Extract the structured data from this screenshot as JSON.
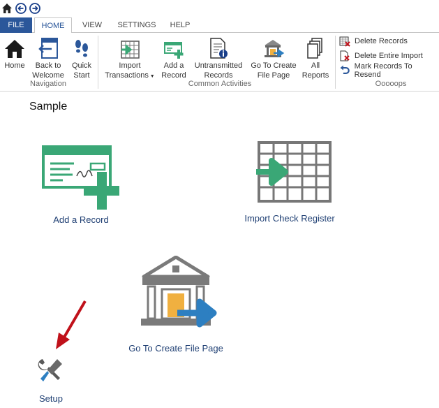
{
  "tabs": {
    "file": "FILE",
    "home": "HOME",
    "view": "VIEW",
    "settings": "SETTINGS",
    "help": "HELP"
  },
  "ribbon": {
    "navigation": {
      "label": "Navigation",
      "home": "Home",
      "back_line1": "Back to",
      "back_line2": "Welcome",
      "quick_line1": "Quick",
      "quick_line2": "Start"
    },
    "common": {
      "label": "Common Activities",
      "import_line1": "Import",
      "import_line2": "Transactions",
      "add_line1": "Add a",
      "add_line2": "Record",
      "untrans_line1": "Untransmitted",
      "untrans_line2": "Records",
      "goto_line1": "Go To Create",
      "goto_line2": "File Page",
      "all_line1": "All",
      "all_line2": "Reports"
    },
    "oops": {
      "label": "Ooooops",
      "delete_records": "Delete Records",
      "delete_import": "Delete Entire Import",
      "mark_resend": "Mark Records To Resend"
    }
  },
  "main": {
    "title": "Sample",
    "tiles": {
      "add_record": "Add a Record",
      "import_check": "Import Check Register",
      "goto_file": "Go To Create File Page",
      "setup": "Setup"
    }
  },
  "colors": {
    "accent_blue": "#2b579a",
    "green": "#3aa776",
    "arrow_blue": "#2d7fc1",
    "arrow_red": "#c0111a",
    "label_blue": "#1f3f73"
  },
  "icons": {
    "qat": [
      "home-icon",
      "back-arrow-icon",
      "forward-arrow-icon"
    ],
    "oops": [
      "delete-records-icon",
      "delete-import-icon",
      "undo-arrow-icon"
    ]
  }
}
